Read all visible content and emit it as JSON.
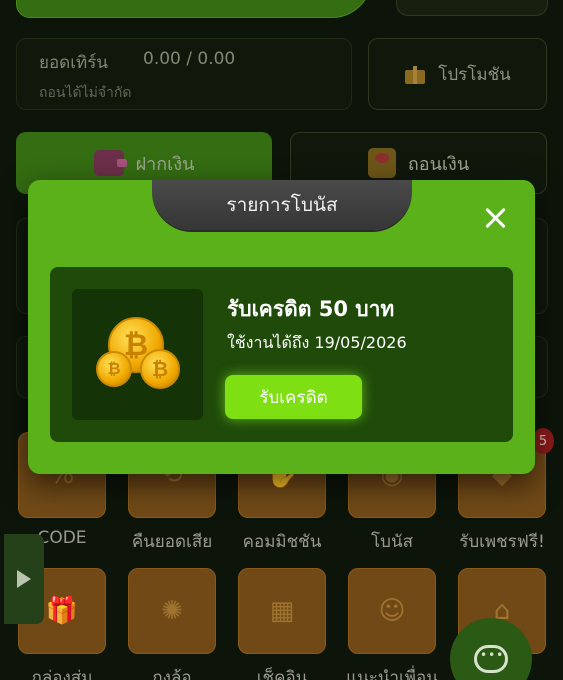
{
  "background": {
    "turnover": {
      "label": "ยอดเทิร์น",
      "value": "0.00 / 0.00",
      "sub": "ถอนได้ไม่จำกัด"
    },
    "promo_button_label": "โปรโมชัน",
    "deposit_label": "ฝากเงิน",
    "withdraw_label": "ถอนเงิน",
    "grid_row1": [
      {
        "label": "CODE",
        "icon": "percent-coupon-icon"
      },
      {
        "label": "คืนยอดเสีย",
        "icon": "cashback-icon"
      },
      {
        "label": "คอมมิชชัน",
        "icon": "commission-icon"
      },
      {
        "label": "โบนัส",
        "icon": "coins-icon"
      },
      {
        "label": "รับเพชรฟรี!",
        "icon": "diamond-icon"
      }
    ],
    "grid_row2": [
      {
        "label": "กล่องสุ่ม",
        "icon": "gift-box-icon"
      },
      {
        "label": "กงล้อ",
        "icon": "wheel-icon"
      },
      {
        "label": "เช็คอิน",
        "icon": "calendar-check-icon"
      },
      {
        "label": "แนะนำเพื่อน",
        "icon": "friends-icon"
      },
      {
        "label": "",
        "icon": "shop-icon"
      }
    ]
  },
  "modal": {
    "title": "รายการโบนัส",
    "bonus": {
      "name": "รับเครดิต 50 บาท",
      "expiry": "ใช้งานได้ถึง 19/05/2026",
      "claim_label": "รับเครดิต",
      "icon": "bitcoin-coins-icon"
    },
    "colors": {
      "panel": "#5bb11a",
      "card": "#1f4a0a",
      "claim_button": "#7ee013",
      "header": "#3d3d3d"
    }
  }
}
